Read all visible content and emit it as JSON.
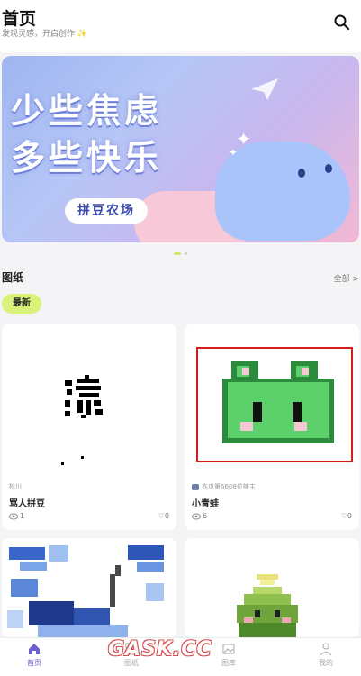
{
  "header": {
    "title": "首页",
    "subtitle": "发现灵感，开启创作 ✨",
    "search_icon": "search-icon"
  },
  "banner": {
    "line1": "少些焦虑",
    "line2": "多些快乐",
    "tag": "拼豆农场",
    "colors": {
      "sky": "#b6c6f6",
      "pink": "#f2b8d4",
      "text_shadow": "#6d7fd8"
    }
  },
  "carousel": {
    "active_index": 0,
    "count": 2
  },
  "section": {
    "title": "图纸",
    "more": "全部 >"
  },
  "filter": {
    "chip": "最新"
  },
  "cards": [
    {
      "author": "松川",
      "title": "骂人拼豆",
      "views": "1",
      "likes": "0"
    },
    {
      "author": "衣瓜第6608位摊主",
      "title": "小青蛙",
      "views": "6",
      "likes": "0"
    }
  ],
  "tabbar": {
    "items": [
      {
        "label": "首页",
        "icon": "home-icon",
        "active": true
      },
      {
        "label": "图纸",
        "icon": "grid-icon",
        "active": false
      },
      {
        "label": "图库",
        "icon": "image-icon",
        "active": false
      },
      {
        "label": "我的",
        "icon": "person-icon",
        "active": false
      }
    ],
    "accent": "#6b5fd1"
  },
  "watermark": "GASK.CC"
}
